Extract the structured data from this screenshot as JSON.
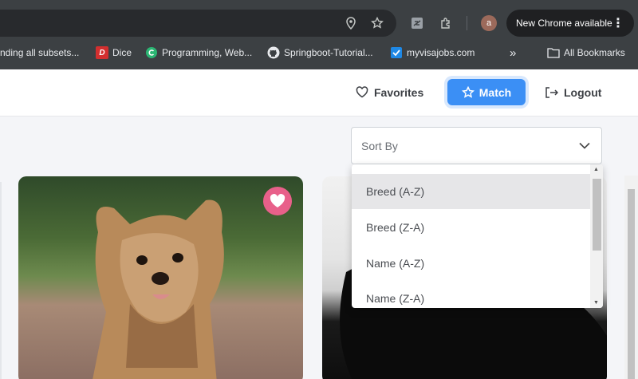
{
  "browser": {
    "omnibox_actions": [
      "location-icon",
      "bookmark-star-icon"
    ],
    "extensions": [
      "extension-icon",
      "puzzle-icon"
    ],
    "profile_initial": "a",
    "update_label": "New Chrome available"
  },
  "bookmarks": [
    {
      "label": "nding all subsets...",
      "icon": "page-icon"
    },
    {
      "label": "Dice",
      "icon": "dice-icon",
      "icon_text": "D",
      "icon_color": "#d32f2f"
    },
    {
      "label": "Programming, Web...",
      "icon": "site-icon",
      "icon_color": "#2bb673"
    },
    {
      "label": "Springboot-Tutorial...",
      "icon": "github-icon"
    },
    {
      "label": "myvisajobs.com",
      "icon": "check-icon",
      "icon_color": "#1e88e5"
    }
  ],
  "bookmarks_more": "»",
  "all_bookmarks": "All Bookmarks",
  "nav": {
    "favorites": "Favorites",
    "match": "Match",
    "logout": "Logout"
  },
  "sort": {
    "placeholder": "Sort By",
    "options": [
      "Breed (A-Z)",
      "Breed (Z-A)",
      "Name (A-Z)",
      "Name (Z-A)"
    ],
    "highlighted_index": 0
  },
  "colors": {
    "accent": "#3b8ff5",
    "favorite": "#e8608a"
  }
}
